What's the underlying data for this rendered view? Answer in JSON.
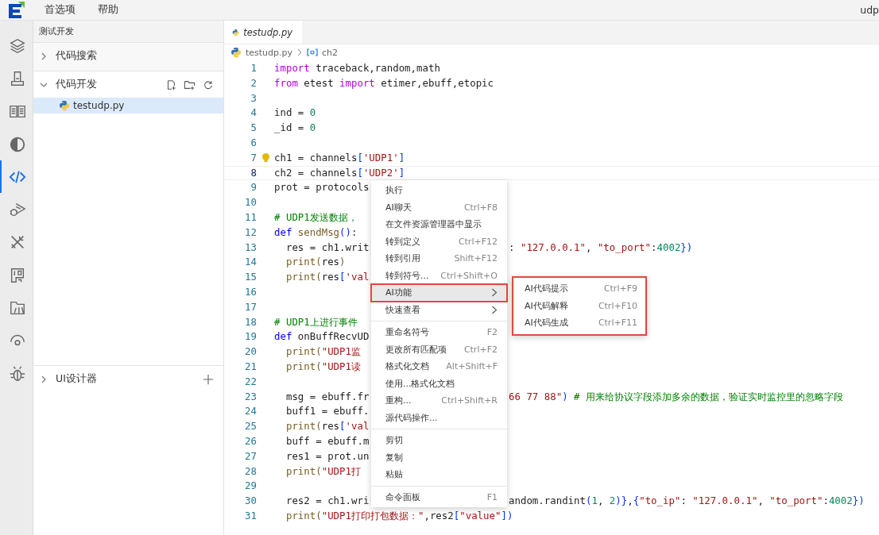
{
  "menubar": {
    "items": [
      "首选项",
      "帮助"
    ],
    "title": "udp"
  },
  "activity_bar": [
    {
      "selected": false
    },
    {
      "selected": false
    },
    {
      "selected": false
    },
    {
      "selected": false
    },
    {
      "selected": true
    },
    {
      "selected": false
    },
    {
      "selected": false
    },
    {
      "selected": false
    },
    {
      "selected": false
    },
    {
      "selected": false
    },
    {
      "selected": false
    }
  ],
  "sidebar": {
    "title": "测试开发",
    "sections": [
      {
        "label": "代码搜索",
        "expanded": false
      },
      {
        "label": "代码开发",
        "expanded": true,
        "files": [
          {
            "name": "testudp.py",
            "selected": true
          }
        ]
      },
      {
        "label": "UI设计器",
        "expanded": false
      }
    ]
  },
  "editor": {
    "tabs": [
      {
        "label": "testudp.py",
        "selected": true
      }
    ],
    "breadcrumb": [
      "testudp.py",
      "ch2"
    ],
    "lines": [
      {
        "number": "1",
        "current": false,
        "lightbulb": false,
        "code": [
          {
            "kind": "kw",
            "text": "import"
          },
          {
            "kind": "pl",
            "text": " traceback,random,math"
          }
        ]
      },
      {
        "number": "2",
        "current": false,
        "lightbulb": false,
        "code": [
          {
            "kind": "kw",
            "text": "from"
          },
          {
            "kind": "pl",
            "text": " etest "
          },
          {
            "kind": "kw",
            "text": "import"
          },
          {
            "kind": "pl",
            "text": " etimer,ebuff,etopic"
          }
        ]
      },
      {
        "number": "3",
        "current": false,
        "lightbulb": false
      },
      {
        "number": "4",
        "current": false,
        "lightbulb": false,
        "code": [
          {
            "kind": "pl",
            "text": "ind = "
          },
          {
            "kind": "num",
            "text": "0"
          }
        ]
      },
      {
        "number": "5",
        "current": false,
        "lightbulb": false,
        "code": [
          {
            "kind": "pl",
            "text": "_id = "
          },
          {
            "kind": "num",
            "text": "0"
          }
        ]
      },
      {
        "number": "6",
        "current": false,
        "lightbulb": false
      },
      {
        "number": "7",
        "current": false,
        "lightbulb": true,
        "code": [
          {
            "kind": "pl",
            "text": "ch1 = channels"
          },
          {
            "kind": "br",
            "text": "["
          },
          {
            "kind": "str",
            "text": "'UDP1'"
          },
          {
            "kind": "br",
            "text": "]"
          }
        ]
      },
      {
        "number": "8",
        "current": true,
        "lightbulb": false,
        "code": [
          {
            "kind": "pl",
            "text": "ch2 = channels"
          },
          {
            "kind": "br",
            "text": "["
          },
          {
            "kind": "str",
            "text": "'UDP2'"
          },
          {
            "kind": "br",
            "text": "]"
          }
        ]
      },
      {
        "number": "9",
        "current": false,
        "lightbulb": false,
        "code": [
          {
            "kind": "pl",
            "text": "prot = protocols"
          }
        ]
      },
      {
        "number": "10",
        "current": false,
        "lightbulb": false
      },
      {
        "number": "11",
        "current": false,
        "lightbulb": false,
        "code": [
          {
            "kind": "com",
            "text": "# UDP1发送数据，"
          }
        ]
      },
      {
        "number": "12",
        "current": false,
        "lightbulb": false,
        "code": [
          {
            "kind": "def",
            "text": "def "
          },
          {
            "kind": "fn",
            "text": "sendMsg"
          },
          {
            "kind": "br",
            "text": "()"
          },
          {
            "kind": "pl",
            "text": ":"
          }
        ]
      },
      {
        "number": "13",
        "current": false,
        "lightbulb": false,
        "code": [
          {
            "kind": "pl",
            "text": "  res = ch1.writ"
          }
        ],
        "tail": [
          {
            "kind": "pl",
            "text": ": "
          },
          {
            "kind": "str",
            "text": "\"127.0.0.1\""
          },
          {
            "kind": "pl",
            "text": ", "
          },
          {
            "kind": "str",
            "text": "\"to_port\""
          },
          {
            "kind": "pl",
            "text": ":"
          },
          {
            "kind": "num",
            "text": "4002"
          },
          {
            "kind": "br",
            "text": "})"
          }
        ]
      },
      {
        "number": "14",
        "current": false,
        "lightbulb": false,
        "code": [
          {
            "kind": "fn",
            "text": "  print("
          },
          {
            "kind": "pl",
            "text": "res"
          },
          {
            "kind": "fn",
            "text": ")"
          }
        ]
      },
      {
        "number": "15",
        "current": false,
        "lightbulb": false,
        "code": [
          {
            "kind": "fn",
            "text": "  print("
          },
          {
            "kind": "pl",
            "text": "res"
          },
          {
            "kind": "br",
            "text": "["
          },
          {
            "kind": "str",
            "text": "'val"
          }
        ]
      },
      {
        "number": "16",
        "current": false,
        "lightbulb": false
      },
      {
        "number": "17",
        "current": false,
        "lightbulb": false
      },
      {
        "number": "18",
        "current": false,
        "lightbulb": false,
        "code": [
          {
            "kind": "com",
            "text": "# UDP1上进行事件"
          }
        ]
      },
      {
        "number": "19",
        "current": false,
        "lightbulb": false,
        "code": [
          {
            "kind": "def",
            "text": "def "
          },
          {
            "kind": "pl",
            "text": "onBuffRecvUD"
          }
        ]
      },
      {
        "number": "20",
        "current": false,
        "lightbulb": false,
        "code": [
          {
            "kind": "fn",
            "text": "  print("
          },
          {
            "kind": "str",
            "text": "\"UDP1监"
          }
        ]
      },
      {
        "number": "21",
        "current": false,
        "lightbulb": false,
        "code": [
          {
            "kind": "fn",
            "text": "  print("
          },
          {
            "kind": "str",
            "text": "\"UDP1读"
          }
        ]
      },
      {
        "number": "22",
        "current": false,
        "lightbulb": false
      },
      {
        "number": "23",
        "current": false,
        "lightbulb": false,
        "code": [
          {
            "kind": "pl",
            "text": "  msg = ebuff.fr"
          }
        ],
        "tail": [
          {
            "kind": "str",
            "text": "66 77 88\""
          },
          {
            "kind": "br",
            "text": ")"
          },
          {
            "kind": "com",
            "text": " # 用来给协议字段添加多余的数据，验证实时监控里的忽略字段"
          }
        ]
      },
      {
        "number": "24",
        "current": false,
        "lightbulb": false,
        "code": [
          {
            "kind": "pl",
            "text": "  buff1 = ebuff."
          }
        ]
      },
      {
        "number": "25",
        "current": false,
        "lightbulb": false,
        "code": [
          {
            "kind": "fn",
            "text": "  print("
          },
          {
            "kind": "pl",
            "text": "res"
          },
          {
            "kind": "br",
            "text": "["
          },
          {
            "kind": "str",
            "text": "'val"
          }
        ]
      },
      {
        "number": "26",
        "current": false,
        "lightbulb": false,
        "code": [
          {
            "kind": "pl",
            "text": "  buff = ebuff.m"
          }
        ]
      },
      {
        "number": "27",
        "current": false,
        "lightbulb": false,
        "code": [
          {
            "kind": "pl",
            "text": "  res1 = prot.un"
          }
        ]
      },
      {
        "number": "28",
        "current": false,
        "lightbulb": false,
        "code": [
          {
            "kind": "fn",
            "text": "  print("
          },
          {
            "kind": "str",
            "text": "\"UDP1打"
          }
        ]
      },
      {
        "number": "29",
        "current": false,
        "lightbulb": false
      },
      {
        "number": "30",
        "current": false,
        "lightbulb": false,
        "code": [
          {
            "kind": "pl",
            "text": "  res2 = ch1.wri"
          }
        ],
        "tail": [
          {
            "kind": "pl",
            "text": "andom.randint"
          },
          {
            "kind": "br",
            "text": "("
          },
          {
            "kind": "num",
            "text": "1"
          },
          {
            "kind": "pl",
            "text": ", "
          },
          {
            "kind": "num",
            "text": "2"
          },
          {
            "kind": "br",
            "text": ")}"
          },
          {
            "kind": "pl",
            "text": ","
          },
          {
            "kind": "br",
            "text": "{"
          },
          {
            "kind": "str",
            "text": "\"to_ip\""
          },
          {
            "kind": "pl",
            "text": ": "
          },
          {
            "kind": "str",
            "text": "\"127.0.0.1\""
          },
          {
            "kind": "pl",
            "text": ", "
          },
          {
            "kind": "str",
            "text": "\"to_port\""
          },
          {
            "kind": "pl",
            "text": ":"
          },
          {
            "kind": "num",
            "text": "4002"
          },
          {
            "kind": "br",
            "text": "})"
          }
        ]
      },
      {
        "number": "31",
        "current": false,
        "lightbulb": false,
        "code": [
          {
            "kind": "fn",
            "text": "  print("
          },
          {
            "kind": "str",
            "text": "\"UDP1打印打包数据：\""
          },
          {
            "kind": "pl",
            "text": ",res2"
          },
          {
            "kind": "br",
            "text": "["
          },
          {
            "kind": "str",
            "text": "\"value\""
          },
          {
            "kind": "br",
            "text": "])"
          }
        ]
      }
    ]
  },
  "context_menu": {
    "groups": [
      [
        {
          "label": "执行",
          "submenu": false,
          "highlighted": false
        },
        {
          "label": "AI聊天",
          "shortcut": "Ctrl+F8",
          "submenu": false,
          "highlighted": false
        },
        {
          "label": "在文件资源管理器中显示",
          "submenu": false,
          "highlighted": false
        },
        {
          "label": "转到定义",
          "shortcut": "Ctrl+F12",
          "submenu": false,
          "highlighted": false
        },
        {
          "label": "转到引用",
          "shortcut": "Shift+F12",
          "submenu": false,
          "highlighted": false
        },
        {
          "label": "转到符号...",
          "shortcut": "Ctrl+Shift+O",
          "submenu": false,
          "highlighted": false
        },
        {
          "label": "AI功能",
          "submenu": true,
          "highlighted": true
        },
        {
          "label": "快速查看",
          "submenu": true,
          "highlighted": false
        }
      ],
      [
        {
          "label": "重命名符号",
          "shortcut": "F2",
          "submenu": false,
          "highlighted": false
        },
        {
          "label": "更改所有匹配项",
          "shortcut": "Ctrl+F2",
          "submenu": false,
          "highlighted": false
        },
        {
          "label": "格式化文档",
          "shortcut": "Alt+Shift+F",
          "submenu": false,
          "highlighted": false
        },
        {
          "label": "使用...格式化文档",
          "submenu": false,
          "highlighted": false
        },
        {
          "label": "重构...",
          "shortcut": "Ctrl+Shift+R",
          "submenu": false,
          "highlighted": false
        },
        {
          "label": "源代码操作...",
          "submenu": false,
          "highlighted": false
        }
      ],
      [
        {
          "label": "剪切",
          "submenu": false,
          "highlighted": false
        },
        {
          "label": "复制",
          "submenu": false,
          "highlighted": false
        },
        {
          "label": "粘贴",
          "submenu": false,
          "highlighted": false
        }
      ],
      [
        {
          "label": "命令面板",
          "shortcut": "F1",
          "submenu": false,
          "highlighted": false
        }
      ]
    ],
    "submenu": {
      "highlighted": true,
      "items": [
        {
          "label": "AI代码提示",
          "shortcut": "Ctrl+F9"
        },
        {
          "label": "AI代码解释",
          "shortcut": "Ctrl+F10"
        },
        {
          "label": "AI代码生成",
          "shortcut": "Ctrl+F11"
        }
      ]
    }
  }
}
